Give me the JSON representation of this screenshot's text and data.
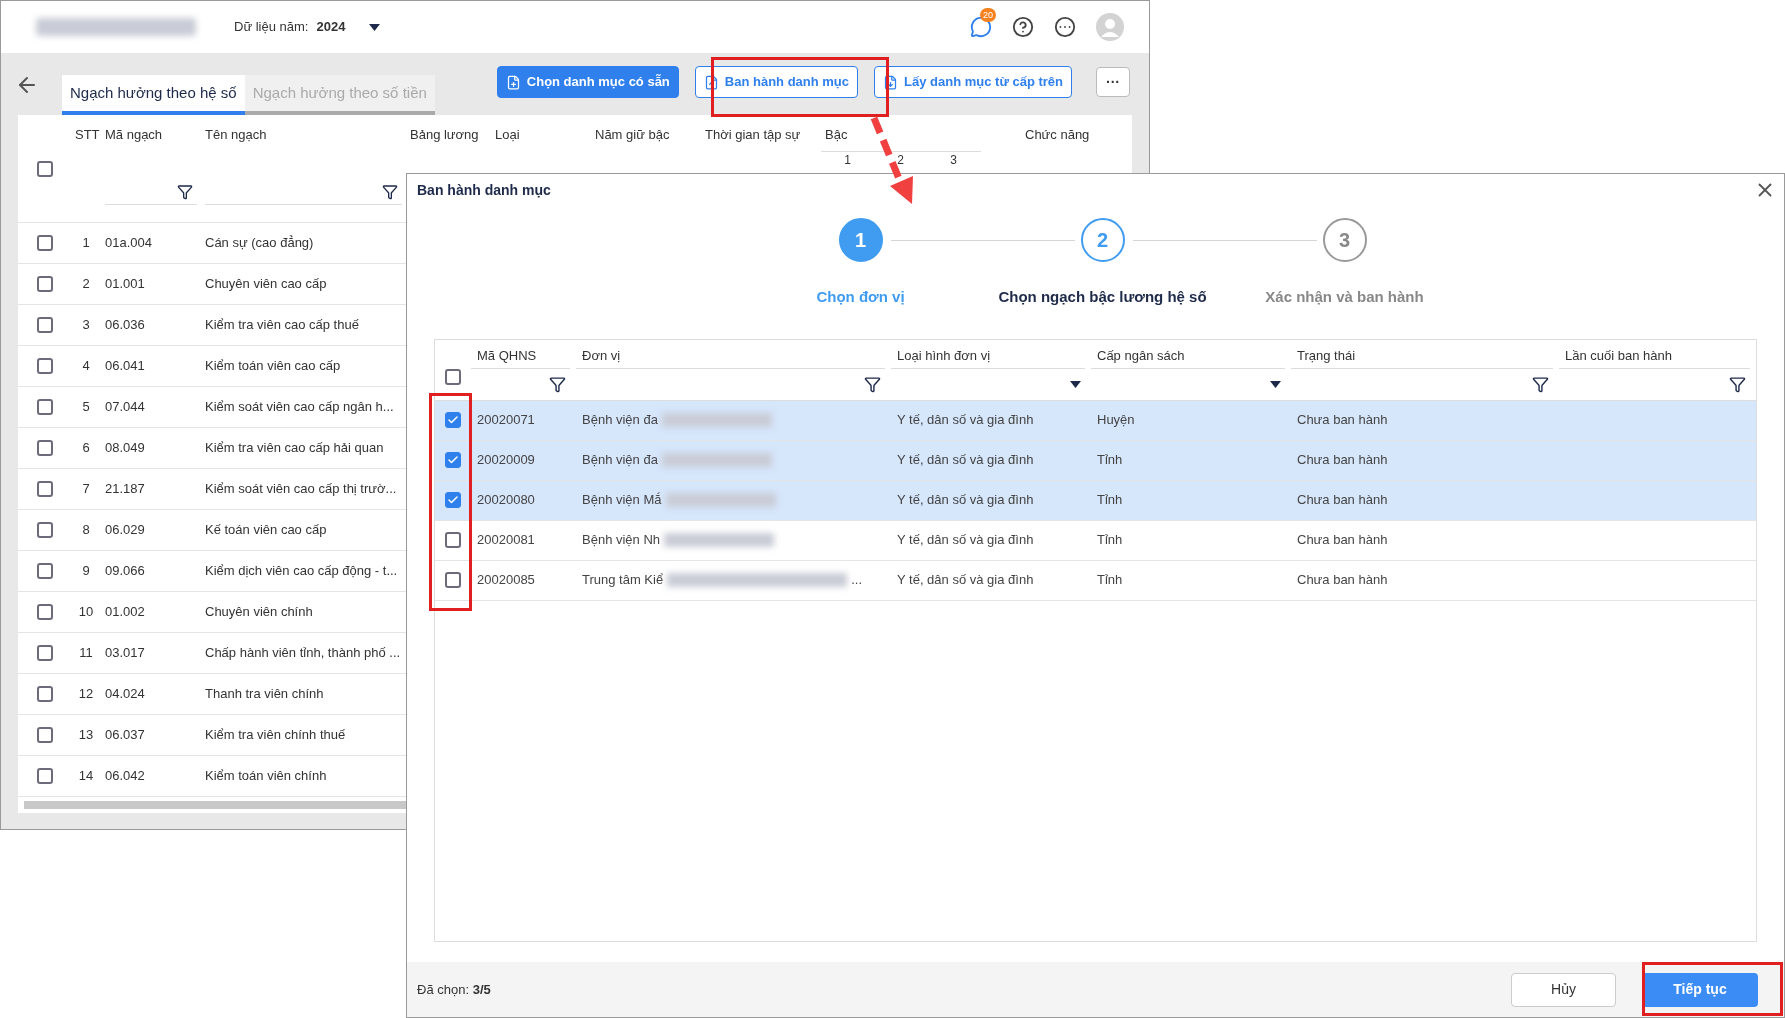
{
  "header": {
    "year_label": "Dữ liệu năm:",
    "year_value": "2024",
    "notification_count": "20"
  },
  "tabs": [
    {
      "label": "Ngạch hưởng theo hệ số",
      "selected": true
    },
    {
      "label": "Ngạch hưởng theo số tiền",
      "selected": false
    }
  ],
  "toolbar_buttons": [
    {
      "label": "Chọn danh mục có sẵn",
      "kind": "primary"
    },
    {
      "label": "Ban hành danh mục",
      "kind": "outline"
    },
    {
      "label": "Lấy danh mục từ cấp trên",
      "kind": "outline"
    },
    {
      "label": "···",
      "kind": "more"
    }
  ],
  "table": {
    "header_checked": false,
    "columns": [
      {
        "label": "STT"
      },
      {
        "label": "Mã ngạch",
        "filter": true
      },
      {
        "label": "Tên ngạch",
        "filter": true
      },
      {
        "label": "Bảng lương"
      },
      {
        "label": "Loại"
      },
      {
        "label": "Năm giữ bậc"
      },
      {
        "label": "Thời gian tập sự"
      },
      {
        "label": "Bậc",
        "sub": [
          "1",
          "2",
          "3"
        ]
      },
      {
        "label": "Chức năng"
      }
    ],
    "rows": [
      {
        "stt": "1",
        "code": "01a.004",
        "name": "Cán sự (cao đẳng)",
        "checked": false
      },
      {
        "stt": "2",
        "code": "01.001",
        "name": "Chuyên viên cao cấp",
        "checked": false
      },
      {
        "stt": "3",
        "code": "06.036",
        "name": "Kiểm tra viên cao cấp thuế",
        "checked": false
      },
      {
        "stt": "4",
        "code": "06.041",
        "name": "Kiểm toán viên cao cấp",
        "checked": false
      },
      {
        "stt": "5",
        "code": "07.044",
        "name": "Kiểm soát viên cao cấp ngân h...",
        "checked": false
      },
      {
        "stt": "6",
        "code": "08.049",
        "name": "Kiểm tra viên cao cấp hải quan",
        "checked": false
      },
      {
        "stt": "7",
        "code": "21.187",
        "name": "Kiểm soát viên cao cấp thị trườ...",
        "checked": false
      },
      {
        "stt": "8",
        "code": "06.029",
        "name": "Kế toán viên cao cấp",
        "checked": false
      },
      {
        "stt": "9",
        "code": "09.066",
        "name": "Kiểm dịch viên cao cấp động - t...",
        "checked": false
      },
      {
        "stt": "10",
        "code": "01.002",
        "name": "Chuyên viên chính",
        "checked": false
      },
      {
        "stt": "11",
        "code": "03.017",
        "name": "Chấp hành viên tỉnh, thành phố ...",
        "checked": false
      },
      {
        "stt": "12",
        "code": "04.024",
        "name": "Thanh tra viên chính",
        "checked": false
      },
      {
        "stt": "13",
        "code": "06.037",
        "name": "Kiểm tra viên chính thuế",
        "checked": false
      },
      {
        "stt": "14",
        "code": "06.042",
        "name": "Kiểm toán viên chính",
        "checked": false
      }
    ]
  },
  "dialog": {
    "title": "Ban hành danh mục",
    "steps": [
      {
        "number": "1",
        "label": "Chọn đơn vị",
        "kind": "active"
      },
      {
        "number": "2",
        "label": "Chọn ngạch bậc lương hệ số",
        "kind": "next"
      },
      {
        "number": "3",
        "label": "Xác nhận và ban hành",
        "kind": "pending"
      }
    ],
    "columns": [
      {
        "label": "Mã QHNS",
        "kind": "funnel"
      },
      {
        "label": "Đơn vị",
        "kind": "funnel"
      },
      {
        "label": "Loại hình đơn vị",
        "kind": "dropdown"
      },
      {
        "label": "Cấp ngân sách",
        "kind": "dropdown"
      },
      {
        "label": "Trạng thái",
        "kind": "funnel"
      },
      {
        "label": "Lần cuối ban hành",
        "kind": "funnel"
      }
    ],
    "header_checked": false,
    "rows": [
      {
        "code": "20020071",
        "unit": "Bệnh viện đa",
        "type": "Y tế, dân số và gia đình",
        "level": "Huyện",
        "status": "Chưa ban hành",
        "selected": true
      },
      {
        "code": "20020009",
        "unit": "Bệnh viện đa",
        "type": "Y tế, dân số và gia đình",
        "level": "Tỉnh",
        "status": "Chưa ban hành",
        "selected": true
      },
      {
        "code": "20020080",
        "unit": "Bệnh viện Mắ",
        "type": "Y tế, dân số và gia đình",
        "level": "Tỉnh",
        "status": "Chưa ban hành",
        "selected": true
      },
      {
        "code": "20020081",
        "unit": "Bệnh viện Nh",
        "type": "Y tế, dân số và gia đình",
        "level": "Tỉnh",
        "status": "Chưa ban hành",
        "selected": false
      },
      {
        "code": "20020085",
        "unit": "Trung tâm Kiể",
        "unit_tail": "...",
        "type": "Y tế, dân số và gia đình",
        "level": "Tỉnh",
        "status": "Chưa ban hành",
        "selected": false
      }
    ],
    "selected_count": "Đã chọn: **3/5**",
    "buttons": [
      {
        "label": "Hủy",
        "kind": "secondary"
      },
      {
        "label": "Tiếp tục",
        "kind": "primary"
      }
    ]
  }
}
